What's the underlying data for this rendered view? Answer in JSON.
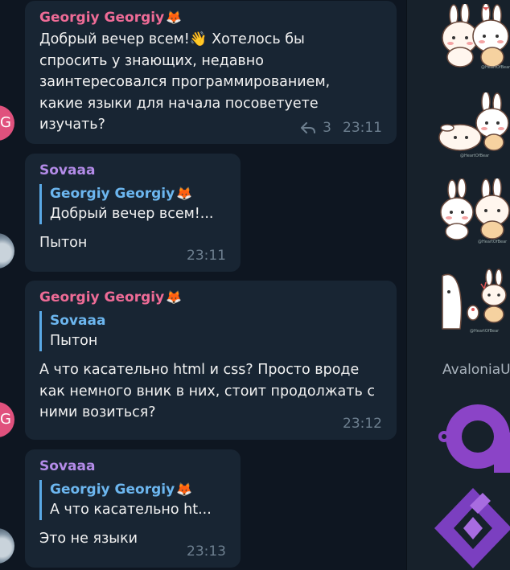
{
  "messages": [
    {
      "author": "Georgiy Georgiy",
      "author_emoji": "🦊",
      "text_lines": [
        "Добрый вечер всем!👋 Хотелось бы",
        "спросить у знающих, недавно",
        "заинтересовался программированием,",
        "какие языки для начала посоветуете",
        "изучать?"
      ],
      "replies_count": "3",
      "time": "23:11",
      "avatar_letter": "G"
    },
    {
      "author": "Sovaaa",
      "reply_to": {
        "name": "Georgiy Georgiy",
        "emoji": "🦊",
        "text": "Добрый вечер всем!..."
      },
      "text": "Пытон",
      "time": "23:11"
    },
    {
      "author": "Georgiy Georgiy",
      "author_emoji": "🦊",
      "reply_to": {
        "name": "Sovaaa",
        "text": "Пытон"
      },
      "text_lines": [
        "А что касательно html и css? Просто вроде",
        "как немного вник в них, стоит продолжать с",
        "ними возиться?"
      ],
      "time": "23:12",
      "avatar_letter": "G"
    },
    {
      "author": "Sovaaa",
      "reply_to": {
        "name": "Georgiy Georgiy",
        "emoji": "🦊",
        "text": "А что касательно ht..."
      },
      "text": "Это не языки",
      "time": "23:13"
    }
  ],
  "side_panel": {
    "sticker_caption": "@HeartOfBear",
    "app_label": "AvaloniaU",
    "accent_color": "#8b44c7"
  }
}
